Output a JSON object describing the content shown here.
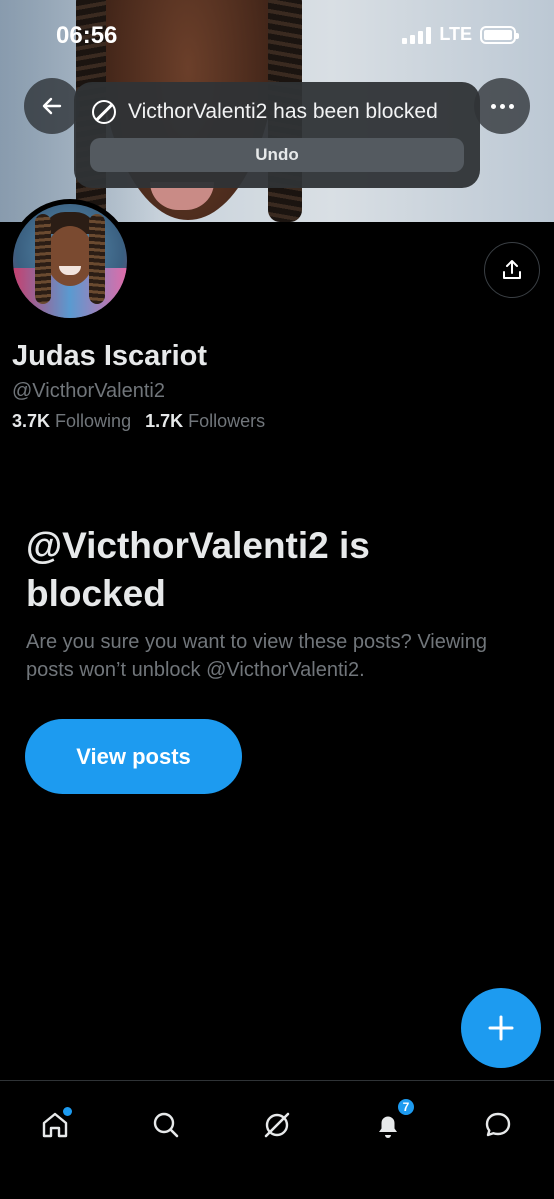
{
  "status_bar": {
    "time": "06:56",
    "network": "LTE"
  },
  "toast": {
    "message": "VicthorValenti2 has been blocked",
    "undo_label": "Undo"
  },
  "profile": {
    "display_name": "Judas Iscariot",
    "handle": "@VicthorValenti2",
    "following_count": "3.7K",
    "following_label": "Following",
    "followers_count": "1.7K",
    "followers_label": "Followers"
  },
  "blocked": {
    "title": "@VicthorValenti2 is blocked",
    "description": "Are you sure you want to view these posts? Viewing posts won’t unblock @VicthorValenti2.",
    "view_posts_label": "View posts"
  },
  "bottom_nav": {
    "items": [
      "home-icon",
      "search-icon",
      "grok-icon",
      "notifications-icon",
      "messages-icon"
    ],
    "notification_count": "7"
  },
  "colors": {
    "accent": "#1d9bf0",
    "background": "#000000",
    "secondary_text": "#71767b"
  }
}
